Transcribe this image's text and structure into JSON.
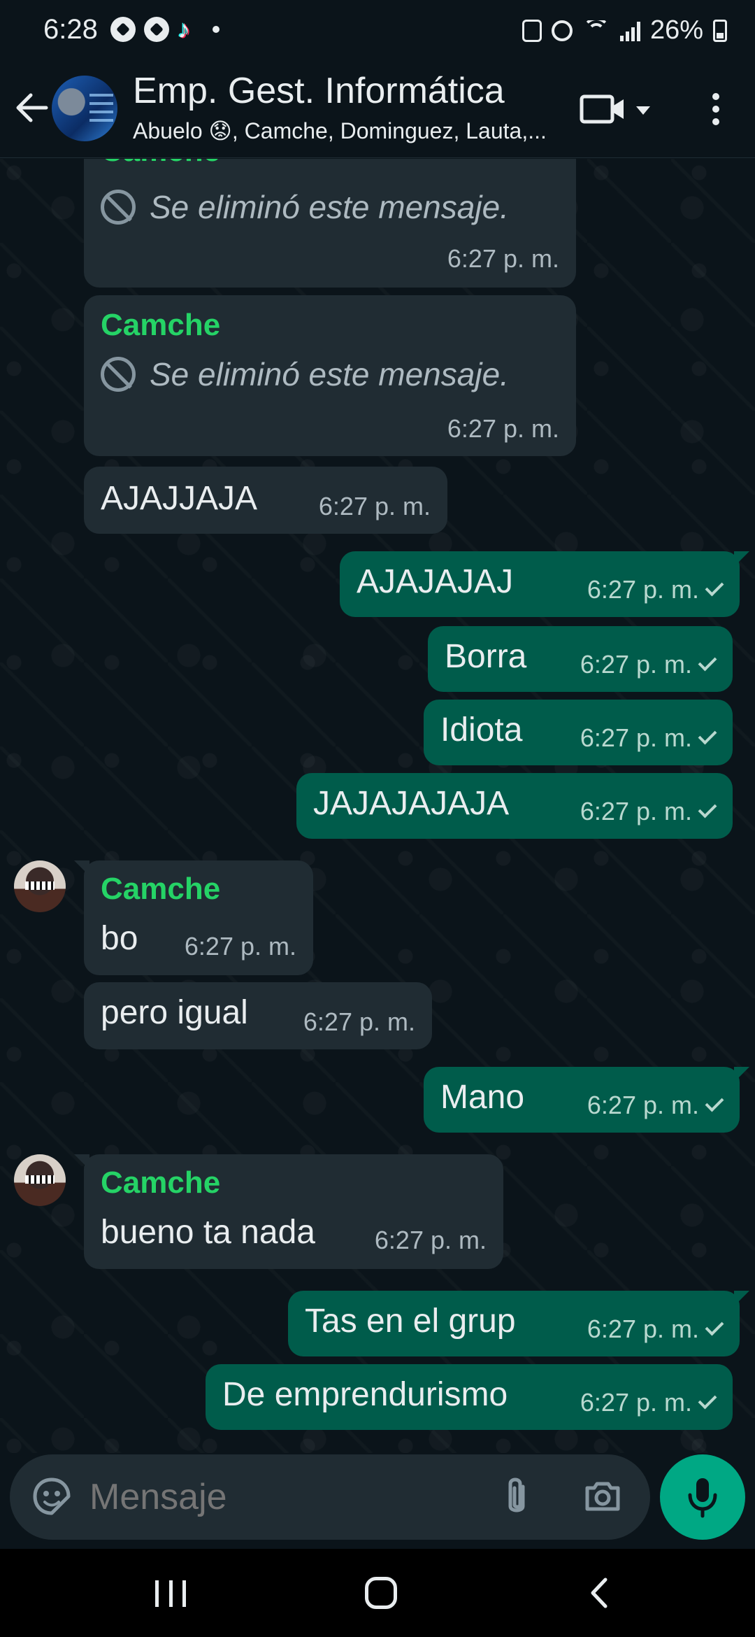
{
  "status_bar": {
    "time": "6:28",
    "battery": "26%",
    "left_icons": [
      "soccer-ball-icon",
      "soccer-ball-icon",
      "tiktok-icon",
      "dot-icon"
    ],
    "right_icons": [
      "screenshot-icon",
      "alarm-icon",
      "wifi-icon",
      "signal-icon",
      "battery-icon"
    ]
  },
  "header": {
    "title": "Emp. Gest. Informática",
    "subtitle": "Abuelo 😟, Camche, Dominguez, Lauta,..."
  },
  "messages": [
    {
      "sender": "Camche",
      "text": "Se eliminó este mensaje.",
      "time": "6:27 p. m.",
      "direction": "in",
      "deleted": true
    },
    {
      "sender": "Camche",
      "text": "Se eliminó este mensaje.",
      "time": "6:27 p. m.",
      "direction": "in",
      "deleted": true
    },
    {
      "text": "AJAJJAJA",
      "time": "6:27 p. m.",
      "direction": "in"
    },
    {
      "text": "AJAJAJAJ",
      "time": "6:27 p. m.",
      "direction": "out"
    },
    {
      "text": "Borra",
      "time": "6:27 p. m.",
      "direction": "out"
    },
    {
      "text": "Idiota",
      "time": "6:27 p. m.",
      "direction": "out"
    },
    {
      "text": "JAJAJAJAJA",
      "time": "6:27 p. m.",
      "direction": "out"
    },
    {
      "sender": "Camche",
      "text": "bo",
      "time": "6:27 p. m.",
      "direction": "in"
    },
    {
      "text": "pero igual",
      "time": "6:27 p. m.",
      "direction": "in"
    },
    {
      "text": "Mano",
      "time": "6:27 p. m.",
      "direction": "out"
    },
    {
      "sender": "Camche",
      "text": "bueno ta nada",
      "time": "6:27 p. m.",
      "direction": "in"
    },
    {
      "text": "Tas en el grup",
      "time": "6:27 p. m.",
      "direction": "out"
    },
    {
      "text": "De emprendurismo",
      "time": "6:27 p. m.",
      "direction": "out"
    }
  ],
  "input": {
    "placeholder": "Mensaje"
  },
  "colors": {
    "background": "#0b141a",
    "incoming_bubble": "#202c33",
    "outgoing_bubble": "#005c4b",
    "sender_name": "#25d366",
    "accent": "#00a884"
  }
}
